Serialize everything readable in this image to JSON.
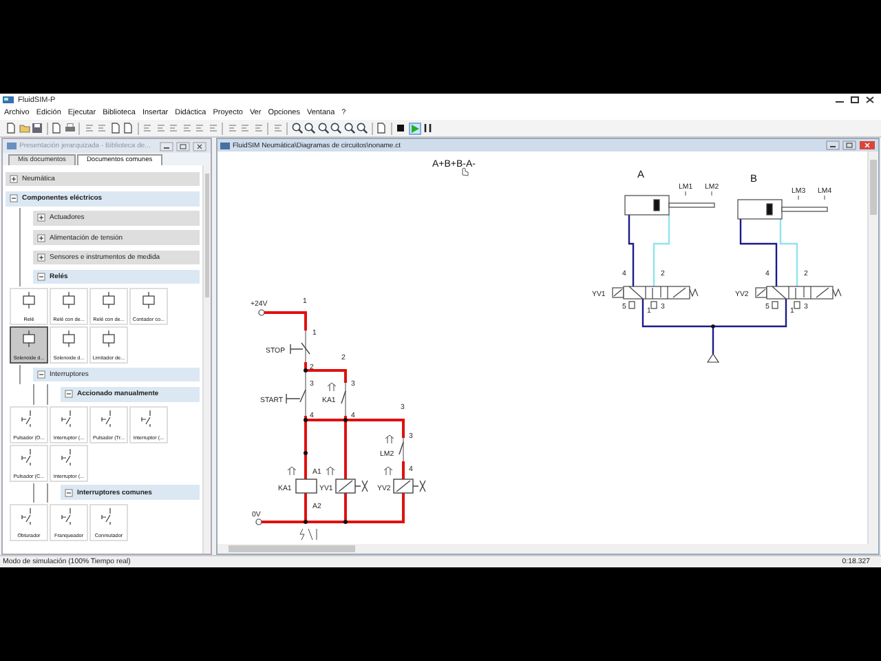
{
  "window": {
    "title": "FluidSIM-P"
  },
  "menu": [
    "Archivo",
    "Edición",
    "Ejecutar",
    "Biblioteca",
    "Insertar",
    "Didáctica",
    "Proyecto",
    "Ver",
    "Opciones",
    "Ventana",
    "?"
  ],
  "simulation": {
    "running": true
  },
  "library": {
    "title": "Presentación jerarquizada - Biblioteca de...",
    "tabs": [
      {
        "label": "Mis documentos",
        "selected": false
      },
      {
        "label": "Documentos comunes",
        "selected": true
      }
    ],
    "tree": [
      {
        "label": "Neumática",
        "expanded": false
      },
      {
        "label": "Componentes eléctricos",
        "expanded": true,
        "children": [
          {
            "label": "Actuadores",
            "expanded": false
          },
          {
            "label": "Alimentación de tensión",
            "expanded": false
          },
          {
            "label": "Sensores e instrumentos de medida",
            "expanded": false
          },
          {
            "label": "Relés",
            "expanded": true,
            "tiles": [
              {
                "label": "Relé",
                "kind": "coil",
                "selected": false
              },
              {
                "label": "Relé con de...",
                "kind": "coil",
                "selected": false
              },
              {
                "label": "Relé con de...",
                "kind": "coil",
                "selected": false
              },
              {
                "label": "Contador co...",
                "kind": "coil",
                "selected": false
              },
              {
                "label": "Solenoide d...",
                "kind": "coil",
                "selected": true
              },
              {
                "label": "Solenoide d...",
                "kind": "coil",
                "selected": false
              },
              {
                "label": "Limitador de...",
                "kind": "coil",
                "selected": false
              }
            ]
          },
          {
            "label": "Interruptores",
            "expanded": true,
            "children": [
              {
                "label": "Accionado manualmente",
                "expanded": true,
                "tiles": [
                  {
                    "label": "Pulsador (O...",
                    "kind": "contact",
                    "selected": false
                  },
                  {
                    "label": "Interruptor (...",
                    "kind": "contact",
                    "selected": false
                  },
                  {
                    "label": "Pulsador (Tr...",
                    "kind": "contact",
                    "selected": false
                  },
                  {
                    "label": "Interruptor (...",
                    "kind": "contact",
                    "selected": false
                  },
                  {
                    "label": "Pulsador (C...",
                    "kind": "contact",
                    "selected": false
                  },
                  {
                    "label": "Interruptor (...",
                    "kind": "contact",
                    "selected": false
                  }
                ]
              },
              {
                "label": "Interruptores comunes",
                "expanded": true,
                "tiles": [
                  {
                    "label": "Obturador",
                    "kind": "contact",
                    "selected": false
                  },
                  {
                    "label": "Franqueador",
                    "kind": "contact",
                    "selected": false
                  },
                  {
                    "label": "Conmutador",
                    "kind": "contact",
                    "selected": false
                  }
                ]
              }
            ]
          }
        ]
      }
    ]
  },
  "document": {
    "title": "FluidSIM Neumática\\Diagramas de circuitos\\noname.ct",
    "sequence": "A+B+B-A-",
    "electrical": {
      "energized": true,
      "labels": [
        "+24V",
        "1",
        "1",
        "STOP",
        "2",
        "2",
        "3",
        "3",
        "START",
        "KA1",
        "4",
        "4",
        "3",
        "3",
        "LM2",
        "4",
        "A1",
        "KA1",
        "YV1",
        "YV2",
        "A2",
        "0V"
      ]
    },
    "pneumatic": {
      "pressurized": true,
      "cylinders": [
        {
          "name": "A",
          "sensors": [
            "LM1",
            "LM2"
          ]
        },
        {
          "name": "B",
          "sensors": [
            "LM3",
            "LM4"
          ]
        }
      ],
      "valves": [
        {
          "tag": "YV1",
          "ports": [
            "4",
            "2",
            "5",
            "1",
            "3"
          ]
        },
        {
          "tag": "YV2",
          "ports": [
            "4",
            "2",
            "5",
            "1",
            "3"
          ]
        }
      ]
    }
  },
  "status_bar": {
    "mode": "Modo de simulación (100% Tiempo real)",
    "time": "0:18.327"
  }
}
